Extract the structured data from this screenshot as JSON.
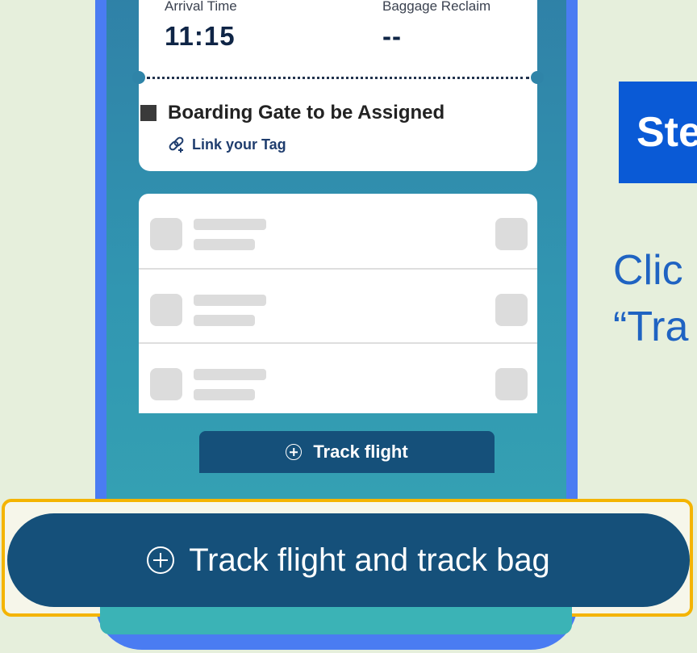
{
  "ticket": {
    "arrival_label": "Arrival Time",
    "arrival_value": "11:15",
    "baggage_label": "Baggage Reclaim",
    "baggage_value": "--",
    "gate_text": "Boarding Gate to be Assigned",
    "link_tag_label": "Link your Tag"
  },
  "buttons": {
    "track_flight": "Track flight",
    "track_flight_and_bag": "Track flight and track bag"
  },
  "instruction": {
    "step_label": "Ste",
    "line1": "Clic",
    "line2": "“Tra"
  },
  "colors": {
    "accent_blue": "#0a5ad6",
    "button_navy": "#15507a",
    "highlight": "#f4b400"
  }
}
